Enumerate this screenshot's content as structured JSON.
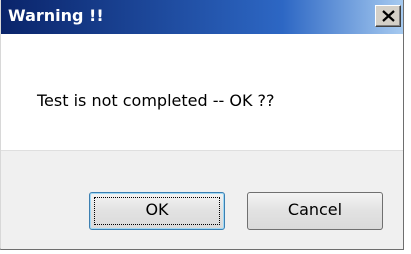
{
  "window": {
    "title": "Warning !!",
    "close_icon": "close-icon"
  },
  "message": {
    "text": "Test is not completed -- OK ??"
  },
  "buttons": {
    "ok_label": "OK",
    "cancel_label": "Cancel"
  },
  "colors": {
    "titlebar_start": "#0a246a",
    "titlebar_end": "#a6caf0",
    "footer_bg": "#f0f0f0"
  }
}
